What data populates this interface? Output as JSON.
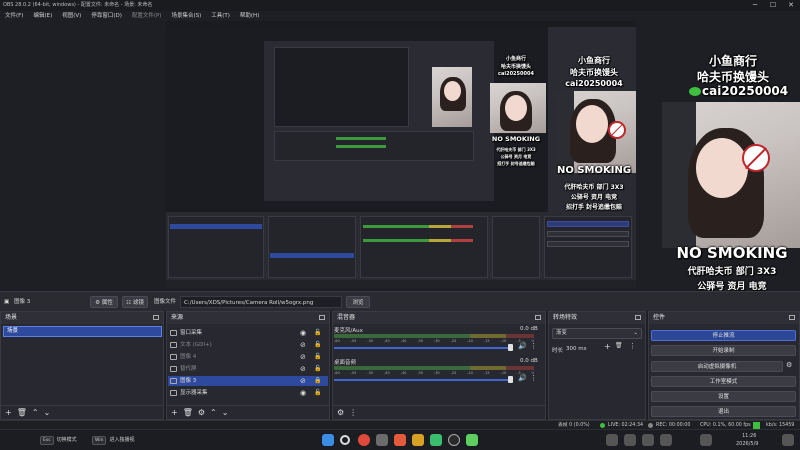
{
  "window": {
    "title": "OBS 28.0.2 (64-bit, windows) - 配置文件: 未命名 - 场景: 未命名",
    "controls": [
      "─",
      "☐",
      "✕"
    ]
  },
  "menu": [
    "文件(F)",
    "编辑(E)",
    "视图(V)",
    "停靠窗口(D)",
    "配置文件(P)",
    "场景集合(S)",
    "工具(T)",
    "帮助(H)"
  ],
  "overlay": {
    "line1": "小鱼商行",
    "line2": "哈夫币换馒头",
    "wechat": "cai20250004",
    "banner": "NO SMOKING",
    "promo1": "代肝哈夫币  部门 3X3",
    "promo2": "公驿号  资月  电竞",
    "promo3": "招打手  封号追缴包赔"
  },
  "source_toolbar": {
    "selected_source": "图像 3",
    "properties": "属性",
    "filters": "滤镜",
    "image_file_label": "图像文件",
    "file_path": "C:/Users/XDS/Pictures/Camera Roll/w5ogrx.png",
    "browse": "浏览"
  },
  "scenes": {
    "title": "场景",
    "items": [
      "场景"
    ]
  },
  "sources": {
    "title": "来源",
    "items": [
      {
        "label": "窗口采集",
        "hidden": false,
        "selected": false
      },
      {
        "label": "文本 (GDI+)",
        "hidden": true,
        "selected": false
      },
      {
        "label": "图像 4",
        "hidden": true,
        "selected": false
      },
      {
        "label": "替代屏",
        "hidden": true,
        "selected": false
      },
      {
        "label": "图像 3",
        "hidden": false,
        "selected": true
      },
      {
        "label": "显示器采集",
        "hidden": false,
        "selected": false
      }
    ]
  },
  "mixer": {
    "title": "混音器",
    "channels": [
      {
        "name": "麦克风/Aux",
        "db": "0.0 dB"
      },
      {
        "name": "桌面音频",
        "db": "0.0 dB"
      }
    ],
    "scale": [
      "-60",
      "-55",
      "-50",
      "-45",
      "-40",
      "-35",
      "-30",
      "-25",
      "-20",
      "-15",
      "-10",
      "-5",
      "0"
    ]
  },
  "transitions": {
    "title": "转场特效",
    "selected": "渐变",
    "duration_label": "时长",
    "duration": "300 ms"
  },
  "controls": {
    "title": "控件",
    "buttons": [
      "停止推流",
      "开始录制",
      "启动虚拟摄像机",
      "工作室模式",
      "设置",
      "退出"
    ]
  },
  "status": {
    "dropped": "丢帧 0 (0.0%)",
    "live": "LIVE: 02:24:34",
    "rec": "REC: 00:00:00",
    "cpu": "CPU: 0.1%, 60.00 fps",
    "kbps": "kb/s: 15459"
  },
  "taskbar": {
    "hint1_key": "Esc",
    "hint1": "切换模式",
    "hint2_key": "Win",
    "hint2": "进入独播视",
    "time": "11:26",
    "date": "2026/5/9"
  },
  "colors": {
    "accent": "#2e4a9e",
    "background": "#1e1f24",
    "panel": "#272830",
    "live": "#3fbf3f"
  }
}
